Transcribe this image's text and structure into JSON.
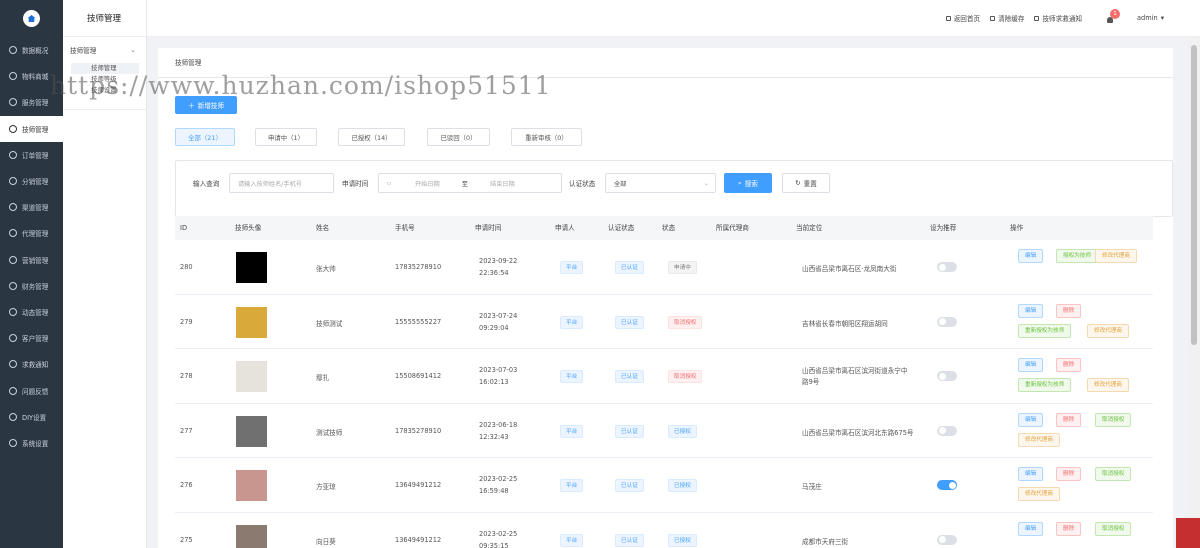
{
  "sidebar": {
    "items": [
      {
        "label": "数据概况",
        "icon": "dashboard-icon"
      },
      {
        "label": "物料商城",
        "icon": "shop-icon"
      },
      {
        "label": "服务管理",
        "icon": "service-icon"
      },
      {
        "label": "技师管理",
        "icon": "technician-icon",
        "active": true
      },
      {
        "label": "订单管理",
        "icon": "order-icon"
      },
      {
        "label": "分销管理",
        "icon": "distribution-icon"
      },
      {
        "label": "渠道管理",
        "icon": "channel-icon"
      },
      {
        "label": "代理管理",
        "icon": "agent-icon"
      },
      {
        "label": "营销管理",
        "icon": "marketing-icon"
      },
      {
        "label": "财务管理",
        "icon": "finance-icon"
      },
      {
        "label": "动态管理",
        "icon": "feed-icon"
      },
      {
        "label": "客户管理",
        "icon": "customer-icon"
      },
      {
        "label": "求救通知",
        "icon": "alert-icon"
      },
      {
        "label": "问题反馈",
        "icon": "feedback-icon"
      },
      {
        "label": "DIY设置",
        "icon": "diy-icon"
      },
      {
        "label": "系统设置",
        "icon": "settings-icon"
      }
    ]
  },
  "subnav": {
    "title": "技师管理",
    "group": "技师管理",
    "items": [
      "技师管理",
      "技师等级",
      "技师设置"
    ]
  },
  "header": {
    "home": "返回首页",
    "clear_cache": "清除缓存",
    "sos": "技师求救通知",
    "badge": "1",
    "user": "admin"
  },
  "breadcrumb": "技师管理",
  "add_button": "新增技师",
  "status_tabs": [
    "全部（21）",
    "申请中（1）",
    "已授权（14）",
    "已驳回（0）",
    "重新审核（0）"
  ],
  "filter": {
    "query_label": "输入查询",
    "query_placeholder": "请输入技师姓名/手机号",
    "time_label": "申请时间",
    "start_placeholder": "开始日期",
    "to": "至",
    "end_placeholder": "结束日期",
    "status_label": "认证状态",
    "status_value": "全部",
    "search": "搜索",
    "reset": "重置"
  },
  "table": {
    "headers": [
      "ID",
      "技师头像",
      "姓名",
      "手机号",
      "申请时间",
      "申请人",
      "认证状态",
      "状态",
      "所属代理商",
      "当前定位",
      "设为推荐",
      "操作"
    ],
    "rows": [
      {
        "id": "280",
        "name": "张大帅",
        "phone": "17835278910",
        "date": "2023-09-22",
        "time": "22:36:54",
        "applicant": "平台",
        "auth": "已认证",
        "status": "申请中",
        "status_type": "gray",
        "location": [
          "山西省吕梁市离石区·龙凤南大街"
        ],
        "recommend": false,
        "ops": [
          [
            "编辑",
            "edit"
          ],
          [
            "授权为技师",
            "green"
          ],
          [
            "修改代理商",
            "orange"
          ]
        ],
        "avatar": "#000000"
      },
      {
        "id": "279",
        "name": "技师测试",
        "phone": "15555555227",
        "date": "2023-07-24",
        "time": "09:29:04",
        "applicant": "平台",
        "auth": "已认证",
        "status": "取消授权",
        "status_type": "red",
        "location": [
          "吉林省长春市朝阳区翔运胡同"
        ],
        "recommend": false,
        "ops": [
          [
            "编辑",
            "edit"
          ],
          [
            "删除",
            "del"
          ],
          [
            "重新授权为技师",
            "green"
          ],
          [
            "修改代理商",
            "orange"
          ]
        ],
        "avatar": "#d9a93a"
      },
      {
        "id": "278",
        "name": "鄢扎",
        "phone": "15508691412",
        "date": "2023-07-03",
        "time": "16:02:13",
        "applicant": "平台",
        "auth": "已认证",
        "status": "取消授权",
        "status_type": "red",
        "location": [
          "山西省吕梁市离石区滨河街道永宁中",
          "路9号"
        ],
        "recommend": false,
        "ops": [
          [
            "编辑",
            "edit"
          ],
          [
            "删除",
            "del"
          ],
          [
            "重新授权为技师",
            "green"
          ],
          [
            "修改代理商",
            "orange"
          ]
        ],
        "avatar": "#e6e2dc"
      },
      {
        "id": "277",
        "name": "测试技师",
        "phone": "17835278910",
        "date": "2023-06-18",
        "time": "12:32:43",
        "applicant": "平台",
        "auth": "已认证",
        "status": "已授权",
        "status_type": "blue",
        "location": [
          "山西省吕梁市离石区滨河北东路675号"
        ],
        "recommend": false,
        "ops": [
          [
            "编辑",
            "edit"
          ],
          [
            "删除",
            "del"
          ],
          [
            "取消授权",
            "green"
          ],
          [
            "修改代理商",
            "orange"
          ]
        ],
        "avatar": "#707070"
      },
      {
        "id": "276",
        "name": "方亚琼",
        "phone": "13649491212",
        "date": "2023-02-25",
        "time": "16:59:48",
        "applicant": "平台",
        "auth": "已认证",
        "status": "已授权",
        "status_type": "blue",
        "location": [
          "马茂庄"
        ],
        "recommend": true,
        "ops": [
          [
            "编辑",
            "edit"
          ],
          [
            "删除",
            "del"
          ],
          [
            "取消授权",
            "green"
          ],
          [
            "修改代理商",
            "orange"
          ]
        ],
        "avatar": "#c9958f"
      },
      {
        "id": "275",
        "name": "向日葵",
        "phone": "13649491212",
        "date": "2023-02-25",
        "time": "09:35:15",
        "applicant": "平台",
        "auth": "已认证",
        "status": "已授权",
        "status_type": "blue",
        "location": [
          "成都市天府三街"
        ],
        "recommend": false,
        "ops": [
          [
            "编辑",
            "edit"
          ],
          [
            "删除",
            "del"
          ],
          [
            "取消授权",
            "green"
          ]
        ],
        "avatar": "#8a7a70"
      }
    ]
  },
  "watermark": "https://www.huzhan.com/ishop51511"
}
